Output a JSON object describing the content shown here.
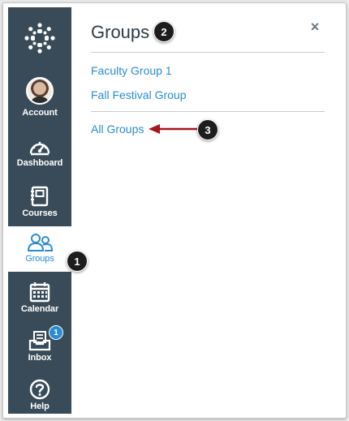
{
  "nav": {
    "logo_icon": "canvas-logo-icon",
    "items": [
      {
        "label": "Account",
        "icon": "avatar"
      },
      {
        "label": "Dashboard",
        "icon": "dashboard-icon"
      },
      {
        "label": "Courses",
        "icon": "courses-icon"
      },
      {
        "label": "Groups",
        "icon": "groups-icon",
        "active": true
      },
      {
        "label": "Calendar",
        "icon": "calendar-icon"
      },
      {
        "label": "Inbox",
        "icon": "inbox-icon",
        "badge": "1"
      },
      {
        "label": "Help",
        "icon": "help-icon"
      }
    ]
  },
  "panel": {
    "title": "Groups",
    "close_icon": "close-icon",
    "close_glyph": "×",
    "links": [
      "Faculty Group 1",
      "Fall Festival Group"
    ],
    "all_link": "All Groups"
  },
  "callouts": [
    "1",
    "2",
    "3"
  ],
  "colors": {
    "nav_bg": "#394b58",
    "link": "#2a8cd2",
    "badge": "#2a8cd2",
    "arrow": "#a3181e",
    "callout_bg": "#1d1d1d"
  }
}
